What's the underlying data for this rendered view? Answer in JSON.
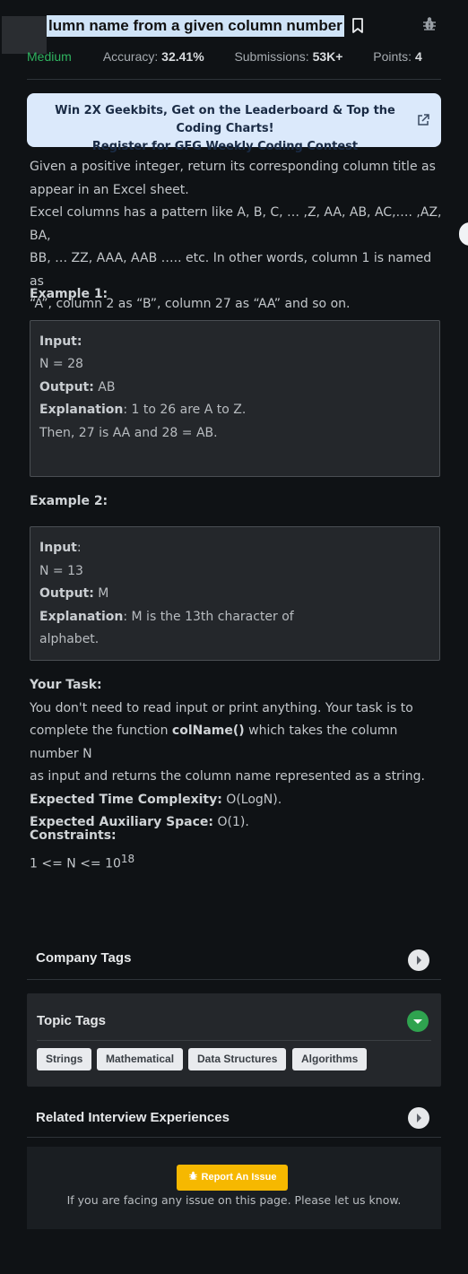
{
  "header": {
    "title": "lumn name from a given column number",
    "difficulty": "Medium",
    "accuracy_label": "Accuracy:",
    "accuracy_value": "32.41%",
    "submissions_label": "Submissions:",
    "submissions_value": "53K+",
    "points_label": "Points:",
    "points_value": "4"
  },
  "banner": {
    "line1": "Win 2X Geekbits, Get on the Leaderboard & Top the Coding Charts!",
    "line2": "Register for GFG Weekly Coding Contest"
  },
  "description": {
    "p1a": "Given a positive integer, return its corresponding column title as",
    "p1b": "appear in an Excel sheet.",
    "p2a": "Excel columns has a pattern like A, B, C, … ,Z, AA, AB, AC,…. ,AZ, BA,",
    "p2b": "BB, … ZZ, AAA, AAB ….. etc. In other words, column 1 is named as",
    "p2c": "“A”, column 2 as “B”, column 27 as “AA” and so on."
  },
  "example1": {
    "heading": "Example 1:",
    "input_label": "Input:",
    "input_value": "N = 28",
    "output_label": "Output:",
    "output_value": "AB",
    "explanation_label": "Explanation",
    "explanation_1": ": 1 to 26 are A to Z.",
    "explanation_2": "Then, 27 is AA and 28 = AB."
  },
  "example2": {
    "heading": "Example 2:",
    "input_label": "Input",
    "input_colon": ":",
    "input_value": "N = 13",
    "output_label": "Output:",
    "output_value": "M",
    "explanation_label": "Explanation",
    "explanation_1": ": M is the 13th character of",
    "explanation_2": "alphabet."
  },
  "task": {
    "heading": "Your Task:",
    "line1": "You don't need to read input or print anything. Your task is to",
    "line2_pre": "complete the function ",
    "function_name": "colName()",
    "line2_post": " which takes the column number N",
    "line3": "as input and returns the column name represented as a string.",
    "time_label": "Expected Time Complexity:",
    "time_value": " O(LogN).",
    "space_label": "Expected Auxiliary Space:",
    "space_value": " O(1)."
  },
  "constraints": {
    "heading": "Constraints:",
    "value": "1 <= N <= 10",
    "exponent": "18"
  },
  "sections": {
    "company_tags": "Company Tags",
    "topic_tags": "Topic Tags",
    "related": "Related Interview Experiences"
  },
  "topic_tags": [
    "Strings",
    "Mathematical",
    "Data Structures",
    "Algorithms"
  ],
  "footer": {
    "report_button": "Report An Issue",
    "facing_text": "If you are facing any issue on this page. Please let us know."
  },
  "colors": {
    "accent_green": "#2fb35f",
    "report_yellow": "#f6b800",
    "banner_bg": "#dbe9fb"
  },
  "icons": {
    "bookmark": "bookmark-icon",
    "bug": "bug-icon",
    "external": "external-link-icon",
    "chevron_right": "chevron-right-icon",
    "chevron_down": "chevron-down-icon"
  }
}
